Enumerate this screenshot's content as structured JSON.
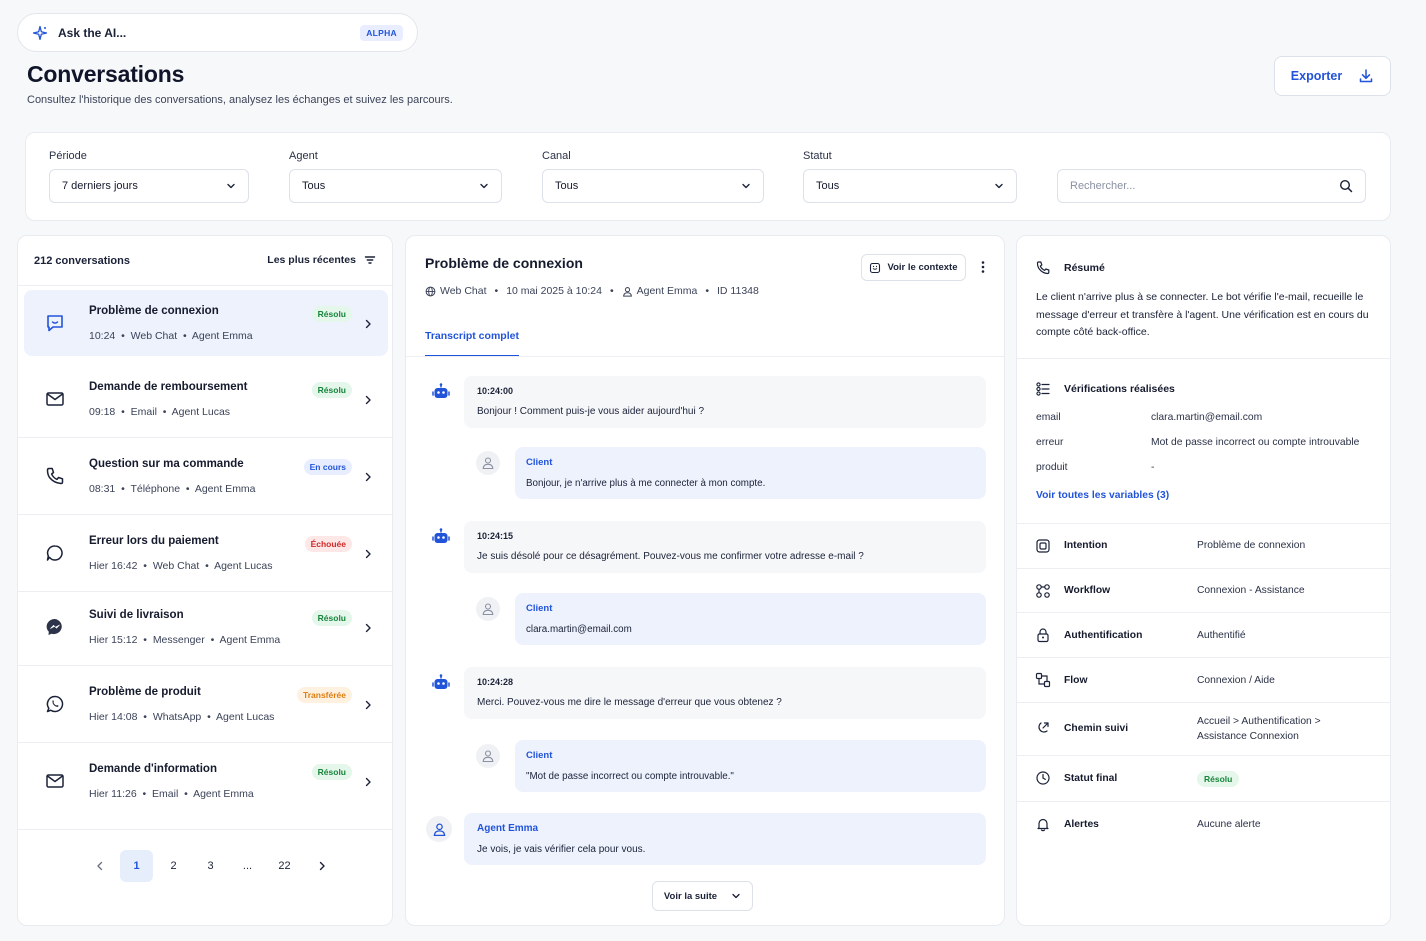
{
  "ask_ai": {
    "label": "Ask the AI...",
    "badge": "ALPHA"
  },
  "header": {
    "title": "Conversations",
    "subtitle": "Consultez l'historique des conversations, analysez les échanges et suivez les parcours.",
    "export_label": "Exporter"
  },
  "filters": {
    "period": {
      "label": "Période",
      "value": "7 derniers jours"
    },
    "agent": {
      "label": "Agent",
      "value": "Tous"
    },
    "channel": {
      "label": "Canal",
      "value": "Tous"
    },
    "status": {
      "label": "Statut",
      "value": "Tous"
    },
    "search_placeholder": "Rechercher..."
  },
  "list": {
    "count": "212 conversations",
    "sort_label": "Les plus récentes",
    "items": [
      {
        "title": "Problème de connexion",
        "time": "10:24",
        "channel": "Web Chat",
        "agent": "Agent Emma",
        "status": "Résolu",
        "icon": "chat-icon"
      },
      {
        "title": "Demande de remboursement",
        "time": "09:18",
        "channel": "Email",
        "agent": "Agent Lucas",
        "status": "Résolu",
        "icon": "mail-icon"
      },
      {
        "title": "Question sur ma commande",
        "time": "08:31",
        "channel": "Téléphone",
        "agent": "Agent Emma",
        "status": "En cours",
        "icon": "phone-icon"
      },
      {
        "title": "Erreur lors du paiement",
        "time": "Hier 16:42",
        "channel": "Web Chat",
        "agent": "Agent Lucas",
        "status": "Échouée",
        "icon": "message-circle-icon"
      },
      {
        "title": "Suivi de livraison",
        "time": "Hier 15:12",
        "channel": "Messenger",
        "agent": "Agent Emma",
        "status": "Résolu",
        "icon": "messenger-icon"
      },
      {
        "title": "Problème de produit",
        "time": "Hier 14:08",
        "channel": "WhatsApp",
        "agent": "Agent Lucas",
        "status": "Transférée",
        "icon": "whatsapp-icon"
      },
      {
        "title": "Demande d'information",
        "time": "Hier 11:26",
        "channel": "Email",
        "agent": "Agent Emma",
        "status": "Résolu",
        "icon": "mail-icon"
      }
    ],
    "pagination": {
      "pages": [
        "1",
        "2",
        "3",
        "...",
        "22"
      ],
      "current": "1"
    }
  },
  "conversation": {
    "title": "Problème de connexion",
    "channel": "Web Chat",
    "date": "10 mai 2025 à 10:24",
    "agent": "Agent Emma",
    "id": "ID 11348",
    "context_button": "Voir le contexte",
    "tab": "Transcript complet",
    "messages": [
      {
        "type": "bot",
        "time": "10:24:00",
        "text": "Bonjour ! Comment puis-je vous aider aujourd'hui ?"
      },
      {
        "type": "client",
        "who": "Client",
        "text": "Bonjour, je n'arrive plus à me connecter à mon compte."
      },
      {
        "type": "bot",
        "time": "10:24:15",
        "text": "Je suis désolé pour ce désagrément. Pouvez-vous me confirmer votre adresse e-mail ?"
      },
      {
        "type": "client",
        "who": "Client",
        "text": "clara.martin@email.com"
      },
      {
        "type": "bot",
        "time": "10:24:28",
        "text": "Merci. Pouvez-vous me dire le message d'erreur que vous obtenez ?"
      },
      {
        "type": "client",
        "who": "Client",
        "text": "\"Mot de passe incorrect ou compte introuvable.\""
      },
      {
        "type": "agent",
        "who": "Agent Emma",
        "text": "Je vois, je vais vérifier cela pour vous."
      }
    ],
    "more_label": "Voir la suite"
  },
  "details": {
    "summary_title": "Résumé",
    "summary_text": "Le client n'arrive plus à se connecter. Le bot vérifie l'e-mail, recueille le message d'erreur et transfère à l'agent. Une vérification est en cours du compte côté back-office.",
    "checks_title": "Vérifications réalisées",
    "variables": [
      {
        "key": "email",
        "value": "clara.martin@email.com"
      },
      {
        "key": "erreur",
        "value": "Mot de passe incorrect ou compte introuvable"
      },
      {
        "key": "produit",
        "value": "-"
      }
    ],
    "all_vars_link": "Voir toutes les variables (3)",
    "rows": [
      {
        "label": "Intention",
        "value": "Problème de connexion",
        "icon": "intent-icon"
      },
      {
        "label": "Workflow",
        "value": "Connexion - Assistance",
        "icon": "workflow-icon"
      },
      {
        "label": "Authentification",
        "value": "Authentifié",
        "icon": "lock-icon"
      },
      {
        "label": "Flow",
        "value": "Connexion / Aide",
        "icon": "flow-icon"
      },
      {
        "label": "Chemin suivi",
        "value_line1": "Accueil > Authentification >",
        "value_line2": "Assistance Connexion",
        "icon": "path-icon"
      },
      {
        "label": "Statut final",
        "value": "Résolu",
        "icon": "status-icon"
      },
      {
        "label": "Alertes",
        "value": "Aucune alerte",
        "icon": "bell-icon"
      }
    ]
  },
  "colors": {
    "accent": "#2254d9",
    "success": "#17853c",
    "danger": "#d22a2a",
    "warning": "#dd7d12",
    "active_bg": "#edf2fd"
  }
}
